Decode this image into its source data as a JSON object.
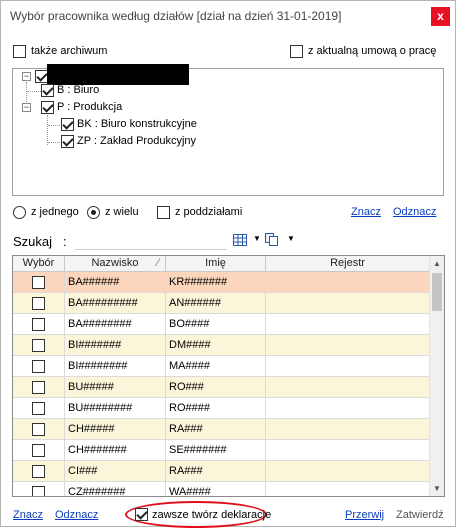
{
  "window": {
    "title": "Wybór pracownika według działów [dział na dzień 31-01-2019]",
    "close_glyph": "x"
  },
  "options": {
    "archive_label": "także archiwum",
    "archive_checked": false,
    "current_contract_label": "z aktualną umową o pracę",
    "current_contract_checked": false
  },
  "tree": {
    "root_redacted": true,
    "nodes": [
      {
        "label": "B : Biuro",
        "checked": true
      },
      {
        "label": "P : Produkcja",
        "checked": true
      },
      {
        "label": "BK : Biuro konstrukcyjne",
        "checked": true
      },
      {
        "label": "ZP : Zakład Produkcyjny",
        "checked": true
      }
    ]
  },
  "mode": {
    "single_label": "z jednego",
    "multi_label": "z wielu",
    "selected": "multi",
    "subdepartments_label": "z poddziałami",
    "subdepartments_checked": false,
    "mark_link": "Znacz",
    "unmark_link": "Odznacz"
  },
  "search": {
    "label": "Szukaj",
    "colon": ":",
    "value": "",
    "icons": [
      "grid-view-icon",
      "copy-icon"
    ]
  },
  "grid": {
    "columns": [
      "Wybór",
      "Nazwisko",
      "Imię",
      "Rejestr"
    ],
    "sort_glyph": "⁄",
    "rows": [
      {
        "surname": "BA######",
        "name": "KR#######",
        "register": "",
        "checked": false,
        "selected": true
      },
      {
        "surname": "BA#########",
        "name": "AN######",
        "register": "",
        "checked": false
      },
      {
        "surname": "BA########",
        "name": "BO####",
        "register": "",
        "checked": false
      },
      {
        "surname": "BI#######",
        "name": "DM####",
        "register": "",
        "checked": false
      },
      {
        "surname": "BI########",
        "name": "MA####",
        "register": "",
        "checked": false
      },
      {
        "surname": "BU#####",
        "name": "RO###",
        "register": "",
        "checked": false
      },
      {
        "surname": "BU########",
        "name": "RO####",
        "register": "",
        "checked": false
      },
      {
        "surname": "CH#####",
        "name": "RA###",
        "register": "",
        "checked": false
      },
      {
        "surname": "CH#######",
        "name": "SE#######",
        "register": "",
        "checked": false
      },
      {
        "surname": "CI###",
        "name": "RA###",
        "register": "",
        "checked": false
      },
      {
        "surname": "CZ#######",
        "name": "WA####",
        "register": "",
        "checked": false
      },
      {
        "surname": "",
        "name": "",
        "register": "",
        "checked": false
      }
    ]
  },
  "footer": {
    "mark_link": "Znacz",
    "unmark_link": "Odznacz",
    "always_create_label": "zawsze twórz deklaracje",
    "always_create_checked": true,
    "interrupt_label": "Przerwij",
    "confirm_label": "Zatwierdź"
  },
  "colors": {
    "selected_row": "#fcd6bc",
    "alt_row": "#fbf6da",
    "link": "#0a3dbd",
    "highlight_ellipse": "#e0101a",
    "close_button": "#e81123"
  }
}
